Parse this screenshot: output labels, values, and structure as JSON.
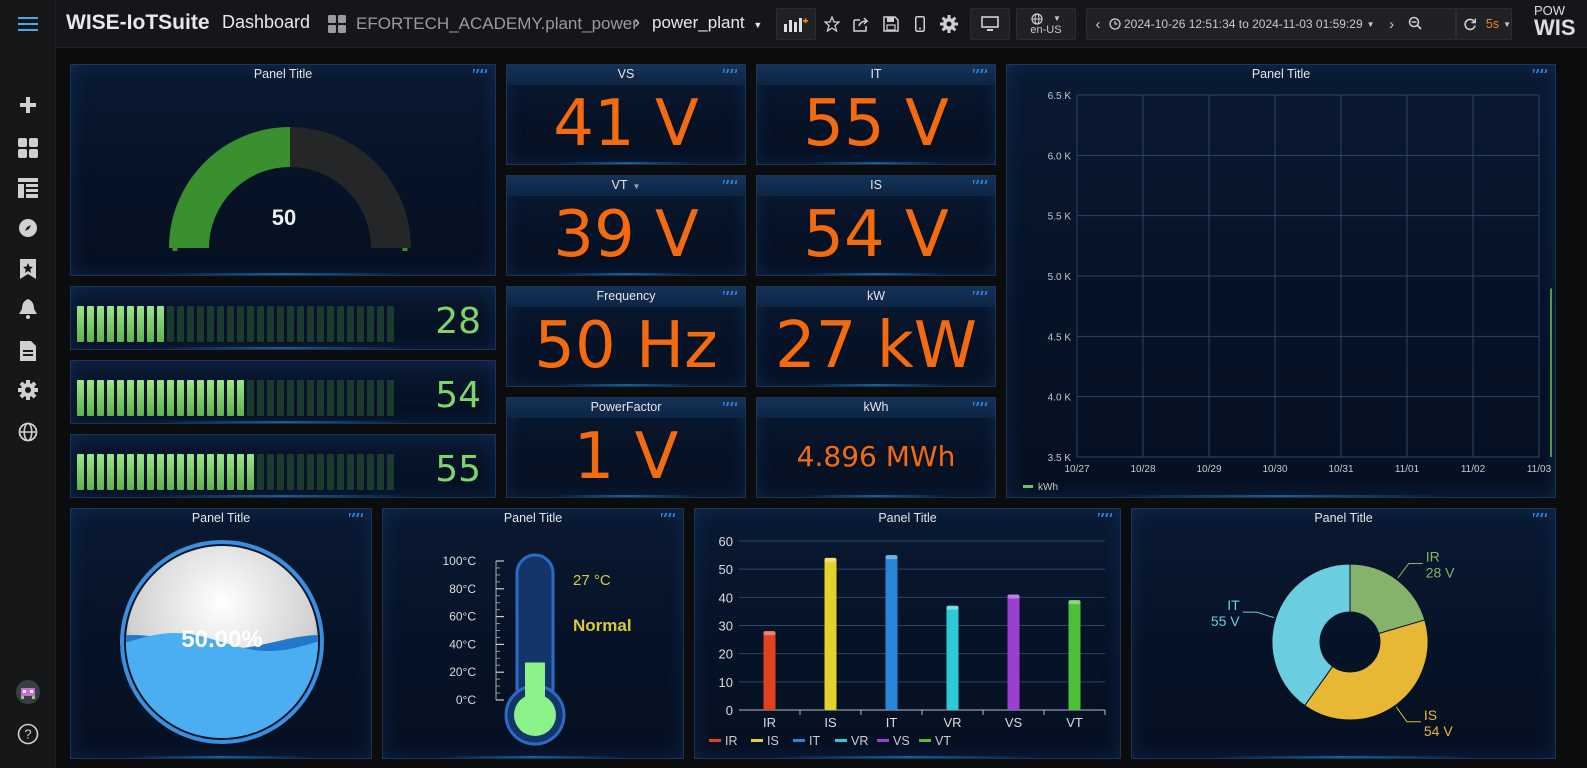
{
  "topbar": {
    "brand": "WISE-IoTSuite",
    "section": "Dashboard",
    "org": "EFORTECH_ACADEMY.plant_power",
    "dashboard": "power_plant",
    "locale": "en-US",
    "time_range": "2024-10-26 12:51:34 to 2024-11-03 01:59:29",
    "refresh": "5s",
    "corner_text_top": "POW",
    "corner_text_bottom": "WIS"
  },
  "gauge_panel": {
    "title": "Panel Title",
    "value": "50",
    "fraction": 0.5
  },
  "lcd_bars": [
    {
      "value": "28",
      "fraction": 0.28
    },
    {
      "value": "54",
      "fraction": 0.54
    },
    {
      "value": "55",
      "fraction": 0.55
    }
  ],
  "stats": [
    {
      "title": "VS",
      "value": "41 V"
    },
    {
      "title": "IT",
      "value": "55 V"
    },
    {
      "title": "VT",
      "value": "39 V"
    },
    {
      "title": "IS",
      "value": "54 V"
    },
    {
      "title": "Frequency",
      "value": "50 Hz"
    },
    {
      "title": "kW",
      "value": "27 kW"
    },
    {
      "title": "PowerFactor",
      "value": "1 V"
    },
    {
      "title": "kWh",
      "value": "4.896 MWh"
    }
  ],
  "colors": {
    "stat": "#f46a0f",
    "lcd_on": "#7fd36a",
    "lcd_off": "#1c3a2e",
    "gauge": "#3a8f2f"
  },
  "line_panel": {
    "title": "Panel Title"
  },
  "liquid_panel": {
    "title": "Panel Title",
    "value": "50.00%",
    "fraction": 0.5
  },
  "thermo_panel": {
    "title": "Panel Title",
    "value": "27 °C",
    "status": "Normal",
    "scale": [
      "100°C",
      "80°C",
      "60°C",
      "40°C",
      "20°C",
      "0°C"
    ],
    "temperature": 27
  },
  "bar_panel": {
    "title": "Panel Title"
  },
  "pie_panel": {
    "title": "Panel Title"
  },
  "chart_data": [
    {
      "type": "line",
      "title": "Panel Title",
      "x": [
        "10/27",
        "10/28",
        "10/29",
        "10/30",
        "10/31",
        "11/01",
        "11/02",
        "11/03"
      ],
      "y_ticks": [
        "3.5 K",
        "4.0 K",
        "4.5 K",
        "5.0 K",
        "5.5 K",
        "6.0 K",
        "6.5 K"
      ],
      "ylim": [
        3500,
        6500
      ],
      "series": [
        {
          "name": "kWh",
          "points": [
            [
              "11/03",
              4896
            ]
          ]
        }
      ],
      "grid": true,
      "legend": "bottom-left"
    },
    {
      "type": "bar",
      "title": "Panel Title",
      "categories": [
        "IR",
        "IS",
        "IT",
        "VR",
        "VS",
        "VT"
      ],
      "values": [
        28,
        54,
        55,
        37,
        41,
        39
      ],
      "colors": [
        "#e0421f",
        "#e3d22b",
        "#2a86d9",
        "#2ec9d6",
        "#9a3fd1",
        "#4fbf3a"
      ],
      "ylim": [
        0,
        60
      ],
      "y_ticks": [
        "0",
        "10",
        "20",
        "30",
        "40",
        "50",
        "60"
      ],
      "legend": "bottom-left"
    },
    {
      "type": "pie",
      "title": "Panel Title",
      "slices": [
        {
          "name": "IR",
          "label": "28 V",
          "value": 28,
          "color": "#86b36b"
        },
        {
          "name": "IS",
          "label": "54 V",
          "value": 54,
          "color": "#e8b835"
        },
        {
          "name": "IT",
          "label": "55 V",
          "value": 55,
          "color": "#6bcde0"
        }
      ]
    }
  ]
}
